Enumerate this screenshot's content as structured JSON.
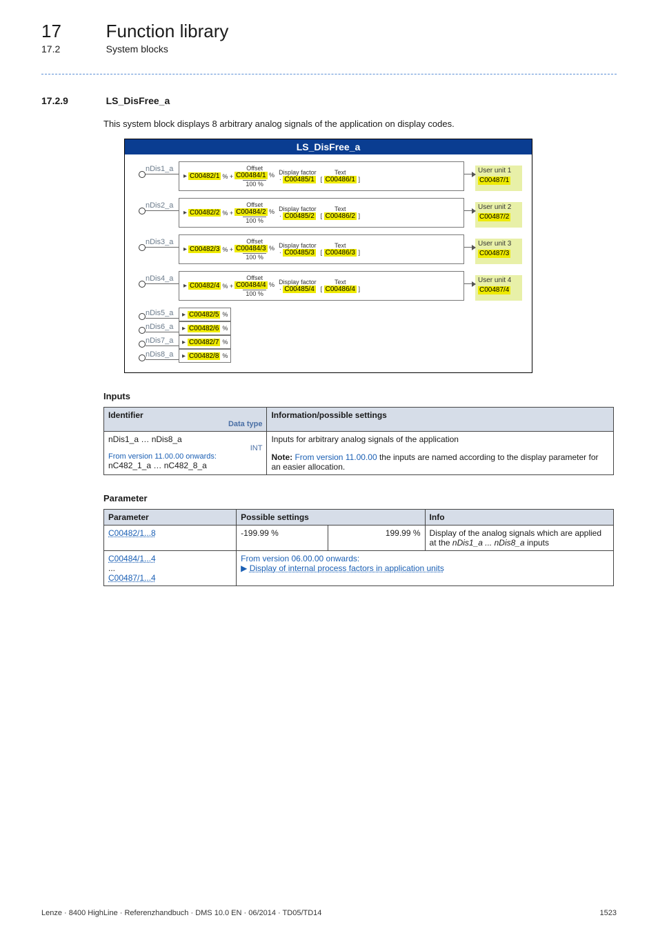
{
  "header": {
    "section_num": "17",
    "section_title": "Function library",
    "subsection_num": "17.2",
    "subsection_title": "System blocks"
  },
  "section": {
    "num": "17.2.9",
    "title": "LS_DisFree_a",
    "desc": "This system block displays 8 arbitrary analog signals of the application on display codes."
  },
  "diagram": {
    "title": "LS_DisFree_a",
    "labels": {
      "offset": "Offset",
      "display_factor": "Display factor",
      "text": "Text",
      "hundred": "100 %",
      "pct": "%",
      "plus": "+",
      "mult": "·",
      "lbr": "[",
      "rbr": "]"
    },
    "channels": [
      {
        "port": "nDis1_a",
        "c1": "C00482/1",
        "c2": "C00484/1",
        "c3": "C00485/1",
        "c4": "C00486/1",
        "unit_label": "User unit 1",
        "unit_code": "C00487/1"
      },
      {
        "port": "nDis2_a",
        "c1": "C00482/2",
        "c2": "C00484/2",
        "c3": "C00485/2",
        "c4": "C00486/2",
        "unit_label": "User unit 2",
        "unit_code": "C00487/2"
      },
      {
        "port": "nDis3_a",
        "c1": "C00482/3",
        "c2": "C00484/3",
        "c3": "C00485/3",
        "c4": "C00486/3",
        "unit_label": "User unit 3",
        "unit_code": "C00487/3"
      },
      {
        "port": "nDis4_a",
        "c1": "C00482/4",
        "c2": "C00484/4",
        "c3": "C00485/4",
        "c4": "C00486/4",
        "unit_label": "User unit 4",
        "unit_code": "C00487/4"
      }
    ],
    "simple_channels": [
      {
        "port": "nDis5_a",
        "code": "C00482/5"
      },
      {
        "port": "nDis6_a",
        "code": "C00482/6"
      },
      {
        "port": "nDis7_a",
        "code": "C00482/7"
      },
      {
        "port": "nDis8_a",
        "code": "C00482/8"
      }
    ]
  },
  "inputs_table": {
    "heading": "Inputs",
    "headers": {
      "identifier": "Identifier",
      "datatype": "Data type",
      "info": "Information/possible settings"
    },
    "row": {
      "id1": "nDis1_a … nDis8_a",
      "int": "INT",
      "from_ver": "From version 11.00.00 onwards:",
      "id2": "nC482_1_a … nC482_8_a",
      "desc1": "Inputs for arbitrary analog signals of the application",
      "note_prefix": "Note: ",
      "note_rest_a": "From version 11.00.00",
      "note_rest_b": " the inputs are named according to the display parameter for an easier allocation."
    }
  },
  "param_table": {
    "heading": "Parameter",
    "headers": {
      "param": "Parameter",
      "settings": "Possible settings",
      "info": "Info"
    },
    "rows": [
      {
        "param": "C00482/1...8",
        "min": "-199.99 %",
        "max": "199.99 %",
        "info_a": "Display of the analog signals which are applied at the ",
        "info_i": "nDis1_a ... nDis8_a",
        "info_b": " inputs"
      }
    ],
    "group": {
      "params": [
        "C00484/1...4",
        "...",
        "C00487/1...4"
      ],
      "from_ver": "From version 06.00.00 onwards:",
      "link": "Display of internal process factors in application units",
      "arrow": "▶"
    }
  },
  "footer": {
    "left": "Lenze · 8400 HighLine · Referenzhandbuch · DMS 10.0 EN · 06/2014 · TD05/TD14",
    "right": "1523"
  }
}
